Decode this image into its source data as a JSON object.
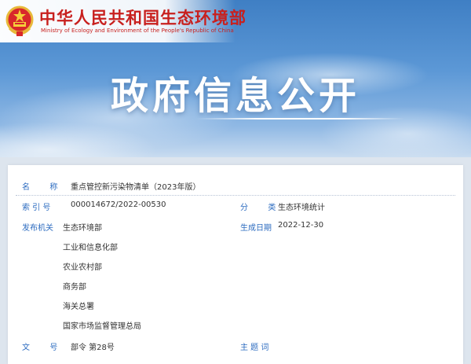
{
  "header": {
    "org_name_cn": "中华人民共和国生态环境部",
    "org_name_en": "Ministry of Ecology and Environment of the People's Republic of China",
    "emblem_icon": "national-emblem-icon",
    "banner_title": "政府信息公开"
  },
  "metadata": {
    "name_label": "名        称",
    "name_value": "重点管控新污染物清单（2023年版）",
    "index_label": "索 引 号",
    "index_value": "000014672/2022-00530",
    "category_label": "分        类",
    "category_value": "生态环境统计",
    "issuer_label": "发布机关",
    "issuers": [
      "生态环境部",
      "工业和信息化部",
      "农业农村部",
      "商务部",
      "海关总署",
      "国家市场监督管理总局"
    ],
    "date_label": "生成日期",
    "date_value": "2022-12-30",
    "doc_no_label": "文        号",
    "doc_no_value": "部令 第28号",
    "subject_label": "主 题 词",
    "subject_value": ""
  },
  "colors": {
    "label": "#2d6cc0",
    "org_red": "#c8201e",
    "banner_blue": "#3f7fc4"
  }
}
